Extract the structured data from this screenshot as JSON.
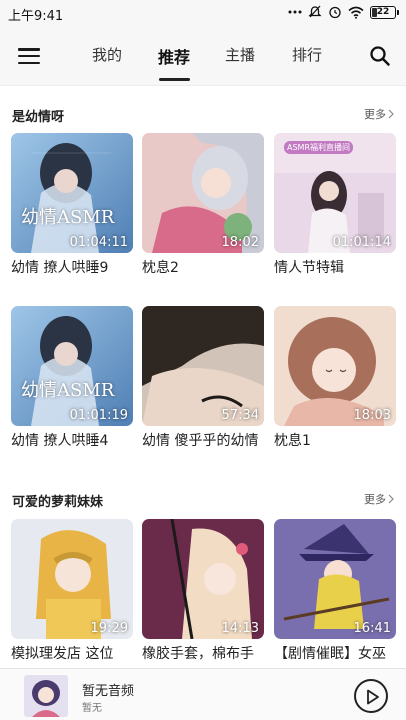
{
  "status": {
    "time": "上午9:41",
    "battery": "22"
  },
  "header": {
    "tabs": [
      {
        "label": "我的"
      },
      {
        "label": "推荐"
      },
      {
        "label": "主播"
      },
      {
        "label": "排行"
      }
    ],
    "active_tab": "推荐"
  },
  "sections": [
    {
      "title": "是幼情呀",
      "more_label": "更多",
      "cards": [
        {
          "title": "幼情 撩人哄睡9",
          "duration": "01:04:11",
          "art_text": "幼情ASMR"
        },
        {
          "title": "枕息2",
          "duration": "18:02"
        },
        {
          "title": "情人节特辑",
          "duration": "01:01:14",
          "art_text": "ASMR福利直播间"
        },
        {
          "title": "幼情 撩人哄睡4",
          "duration": "01:01:19",
          "art_text": "幼情ASMR"
        },
        {
          "title": "幼情 傻乎乎的幼情",
          "duration": "57:34"
        },
        {
          "title": "枕息1",
          "duration": "18:03"
        }
      ]
    },
    {
      "title": "可爱的萝莉妹妹",
      "more_label": "更多",
      "cards": [
        {
          "title": "模拟理发店 这位",
          "duration": "19:29"
        },
        {
          "title": "橡胶手套，棉布手",
          "duration": "14:13"
        },
        {
          "title": "【剧情催眠】女巫",
          "duration": "16:41"
        }
      ]
    }
  ],
  "player": {
    "title": "暂无音频",
    "subtitle": "暂无"
  },
  "colors": {
    "background": "#ffffff",
    "header_bg": "#f7f7f7",
    "text": "#222222",
    "accent": "#111111"
  }
}
